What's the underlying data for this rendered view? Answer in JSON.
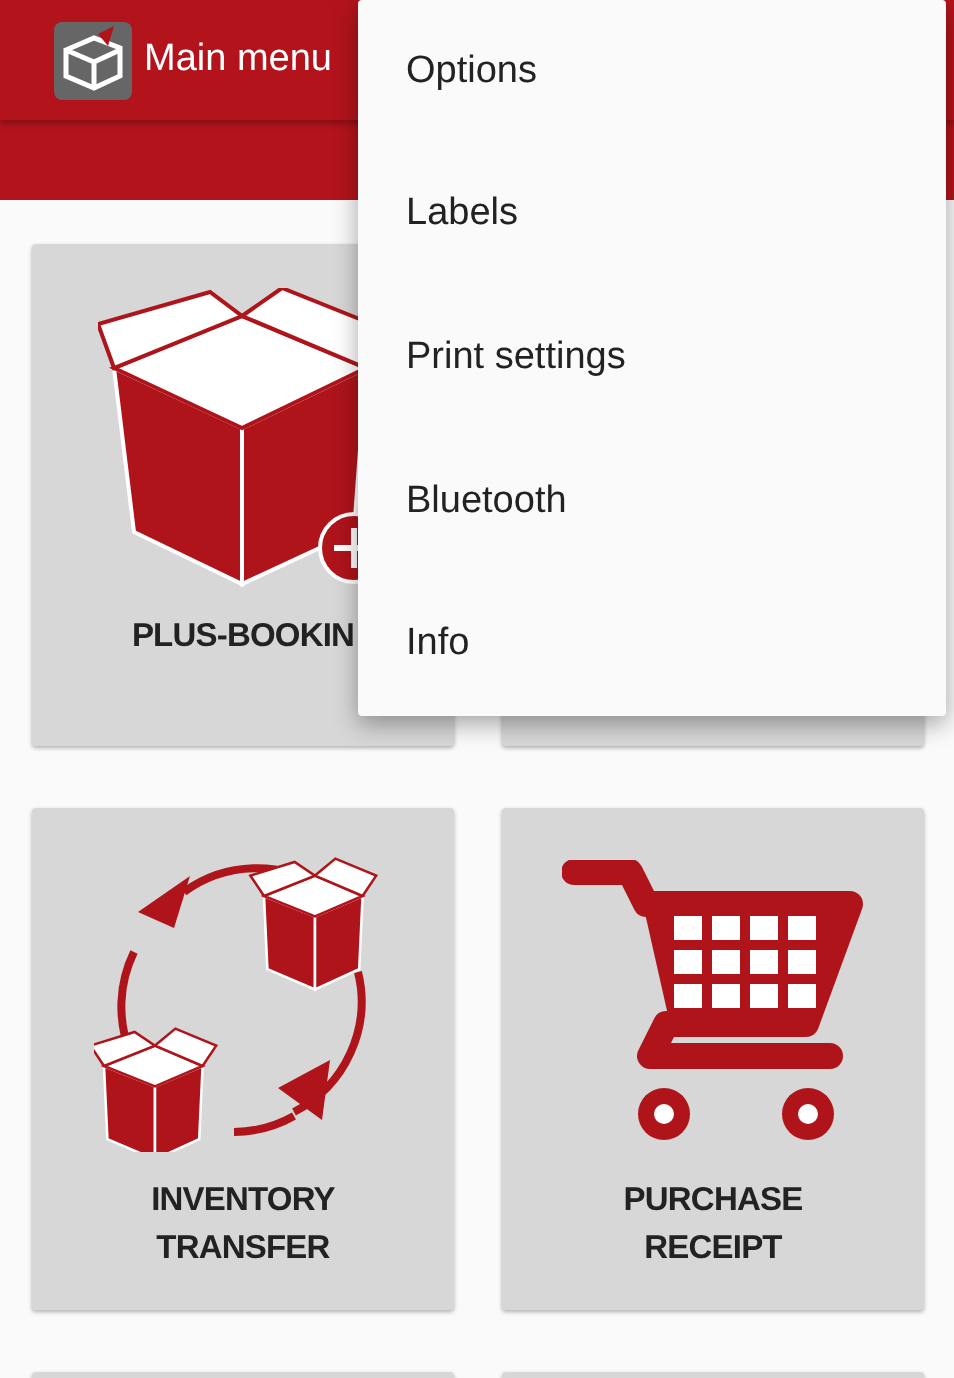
{
  "app_bar": {
    "title": "Main menu"
  },
  "tiles": [
    {
      "kind": "plus",
      "label": "PLUS-BOOKIN"
    },
    {
      "kind": "blank"
    },
    {
      "kind": "transfer",
      "label": "INVENTORY\nTRANSFER"
    },
    {
      "kind": "cart",
      "label": "PURCHASE\nRECEIPT"
    },
    {
      "kind": "blank"
    },
    {
      "kind": "blank"
    }
  ],
  "overflow_menu": {
    "items": [
      "Options",
      "Labels",
      "Print settings",
      "Bluetooth",
      "Info"
    ]
  }
}
